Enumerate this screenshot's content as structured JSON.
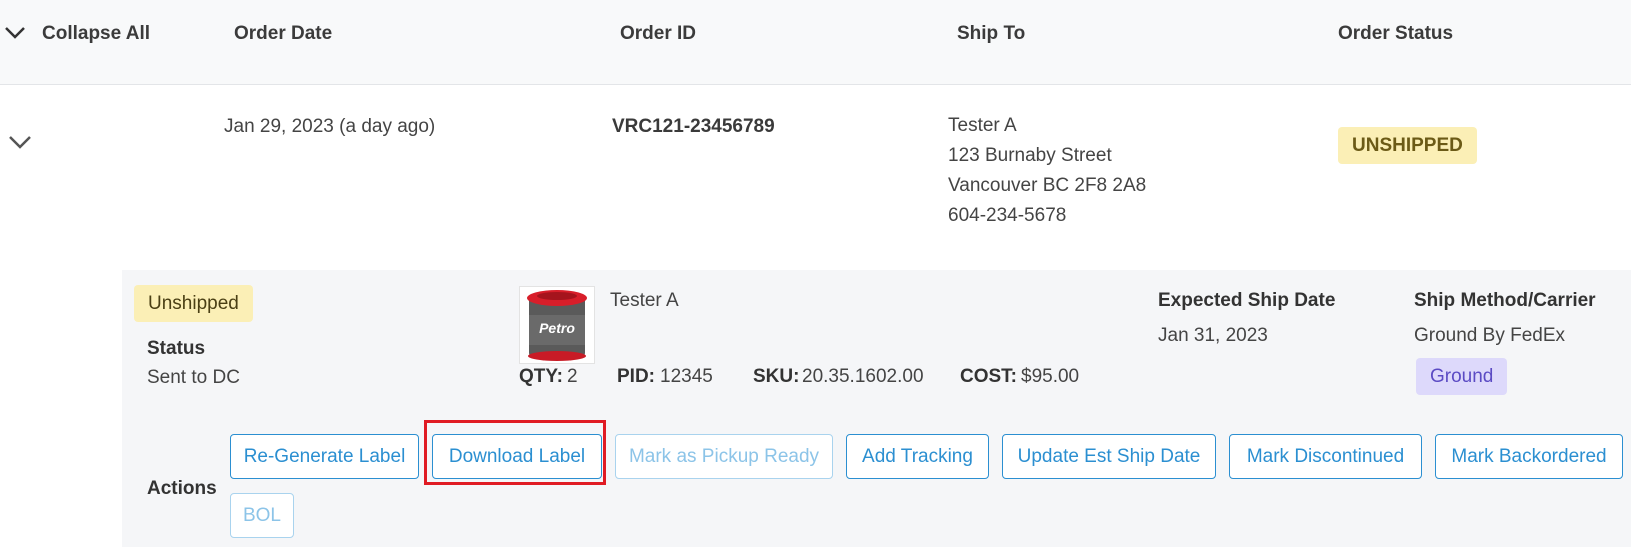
{
  "header": {
    "collapse_all": "Collapse All",
    "order_date": "Order Date",
    "order_id": "Order ID",
    "ship_to": "Ship To",
    "order_status": "Order Status"
  },
  "order": {
    "date": "Jan 29, 2023 (a day ago)",
    "id": "VRC121-23456789",
    "ship_to": {
      "name": "Tester A",
      "street": "123 Burnaby Street",
      "city": "Vancouver BC 2F8 2A8",
      "phone": "604-234-5678"
    },
    "status": "UNSHIPPED",
    "status_color": "#fbefb6"
  },
  "detail": {
    "pill": "Unshipped",
    "status_label": "Status",
    "status_value": "Sent to DC",
    "product": {
      "image_icon": "product-can-image",
      "image_text": "Petro",
      "name": "Tester A",
      "qty_label": "QTY:",
      "qty": "2",
      "pid_label": "PID:",
      "pid": "12345",
      "sku_label": "SKU:",
      "sku": "20.35.1602.00",
      "cost_label": "COST:",
      "cost": "$95.00"
    },
    "expected_ship_label": "Expected Ship Date",
    "expected_ship_value": "Jan 31, 2023",
    "ship_method_label": "Ship Method/Carrier",
    "ship_method_value": "Ground By FedEx",
    "ship_method_pill": "Ground",
    "actions_label": "Actions",
    "actions": {
      "regenerate": "Re-Generate Label",
      "download": "Download Label",
      "pickup_ready": "Mark as Pickup Ready",
      "add_tracking": "Add Tracking",
      "update_ship_date": "Update Est Ship Date",
      "discontinued": "Mark Discontinued",
      "backordered": "Mark Backordered",
      "bol": "BOL"
    }
  },
  "colors": {
    "accent": "#2b8fd1",
    "highlight": "#e01b24",
    "ground_pill": "#ddd9fb"
  }
}
